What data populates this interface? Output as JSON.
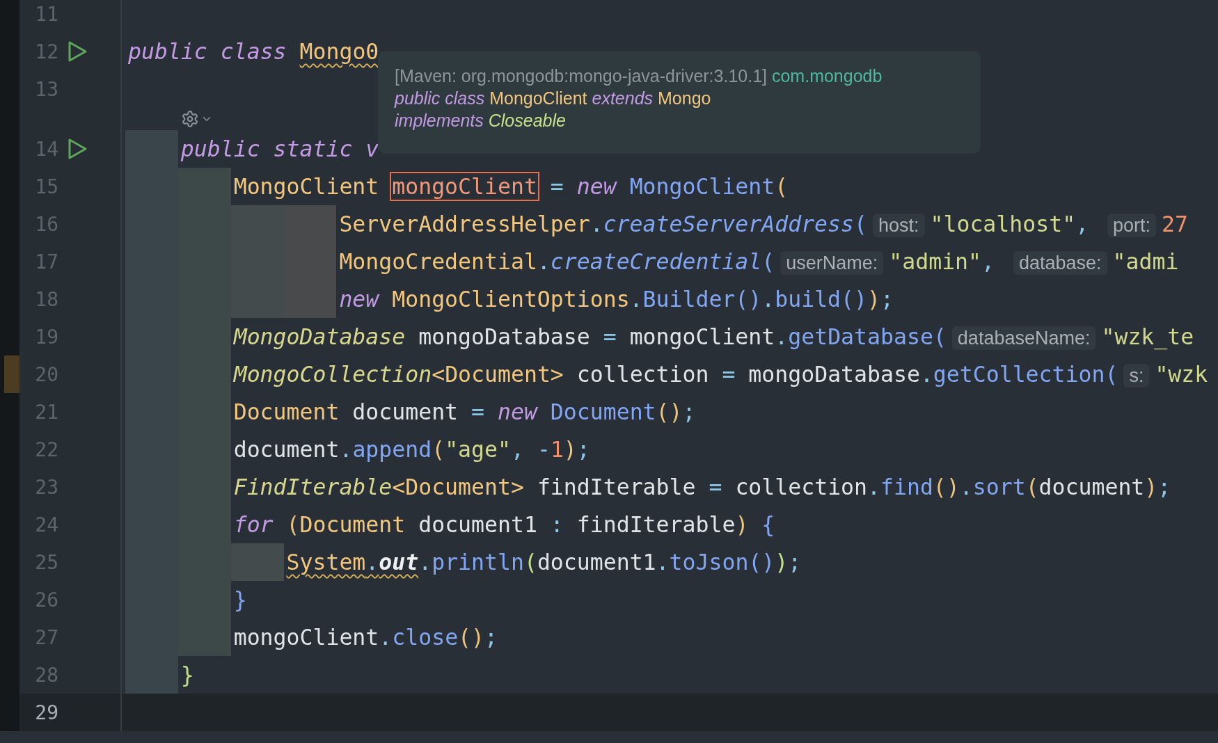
{
  "editor": {
    "lines": [
      {
        "kind": "code",
        "number": "11",
        "run": false,
        "current": false,
        "marker": false
      },
      {
        "kind": "code",
        "number": "12",
        "run": true,
        "current": false,
        "marker": false,
        "tokens": [
          {
            "kind": "kw",
            "text": "public class "
          },
          {
            "kind": "type",
            "text": "Mongo0",
            "warn": true
          }
        ]
      },
      {
        "kind": "code",
        "number": "13",
        "run": false,
        "current": false,
        "marker": false
      },
      {
        "kind": "inlay"
      },
      {
        "kind": "code",
        "number": "14",
        "run": true,
        "current": false,
        "marker": false,
        "guides": [
          {
            "color": "#3a444b"
          }
        ],
        "tokens": [
          {
            "kind": "kw",
            "text": "public static v"
          }
        ]
      },
      {
        "kind": "code",
        "number": "15",
        "run": false,
        "current": false,
        "marker": false,
        "guides": [
          {
            "color": "#3a444b"
          },
          {
            "color": "#3d4949"
          }
        ],
        "tokens": [
          {
            "kind": "type",
            "text": "MongoClient "
          },
          {
            "kind": "ref",
            "text": "mongoClient"
          },
          {
            "kind": "op",
            "text": " = "
          },
          {
            "kind": "kw",
            "text": "new "
          },
          {
            "kind": "method",
            "text": "MongoClient"
          },
          {
            "kind": "p1",
            "text": "("
          }
        ]
      },
      {
        "kind": "code",
        "number": "16",
        "run": false,
        "current": false,
        "marker": false,
        "guides": [
          {
            "color": "#3a444b"
          },
          {
            "color": "#3d4949"
          },
          {
            "color": "#434b4c"
          },
          {
            "color": "#484a4c"
          }
        ],
        "tokens": [
          {
            "kind": "type",
            "text": "ServerAddressHelper"
          },
          {
            "kind": "op",
            "text": "."
          },
          {
            "kind": "imethod",
            "text": "createServerAddress"
          },
          {
            "kind": "p2",
            "text": "("
          },
          {
            "kind": "hint",
            "text": "host:"
          },
          {
            "kind": "string",
            "text": "\"localhost\""
          },
          {
            "kind": "op",
            "text": ", "
          },
          {
            "kind": "hint",
            "text": "port:"
          },
          {
            "kind": "number",
            "text": "27"
          }
        ]
      },
      {
        "kind": "code",
        "number": "17",
        "run": false,
        "current": false,
        "marker": false,
        "guides": [
          {
            "color": "#3a444b"
          },
          {
            "color": "#3d4949"
          },
          {
            "color": "#434b4c"
          },
          {
            "color": "#484a4c"
          }
        ],
        "tokens": [
          {
            "kind": "type",
            "text": "MongoCredential"
          },
          {
            "kind": "op",
            "text": "."
          },
          {
            "kind": "imethod",
            "text": "createCredential"
          },
          {
            "kind": "p2",
            "text": "("
          },
          {
            "kind": "hint",
            "text": "userName:"
          },
          {
            "kind": "string",
            "text": "\"admin\""
          },
          {
            "kind": "op",
            "text": ", "
          },
          {
            "kind": "hint",
            "text": "database:"
          },
          {
            "kind": "string",
            "text": "\"admi"
          }
        ]
      },
      {
        "kind": "code",
        "number": "18",
        "run": false,
        "current": false,
        "marker": false,
        "guides": [
          {
            "color": "#3a444b"
          },
          {
            "color": "#3d4949"
          },
          {
            "color": "#434b4c"
          },
          {
            "color": "#484a4c"
          }
        ],
        "tokens": [
          {
            "kind": "kw",
            "text": "new "
          },
          {
            "kind": "type",
            "text": "MongoClientOptions"
          },
          {
            "kind": "op",
            "text": "."
          },
          {
            "kind": "method",
            "text": "Builder"
          },
          {
            "kind": "p2",
            "text": "()"
          },
          {
            "kind": "op",
            "text": "."
          },
          {
            "kind": "method",
            "text": "build"
          },
          {
            "kind": "p2",
            "text": "()"
          },
          {
            "kind": "p1",
            "text": ")"
          },
          {
            "kind": "op",
            "text": ";"
          }
        ]
      },
      {
        "kind": "code",
        "number": "19",
        "run": false,
        "current": false,
        "marker": false,
        "guides": [
          {
            "color": "#3a444b"
          },
          {
            "color": "#3d4949"
          }
        ],
        "tokens": [
          {
            "kind": "itype",
            "text": "MongoDatabase"
          },
          {
            "kind": "plain",
            "text": " mongoDatabase "
          },
          {
            "kind": "op",
            "text": "= "
          },
          {
            "kind": "plain",
            "text": "mongoClient"
          },
          {
            "kind": "op",
            "text": "."
          },
          {
            "kind": "method",
            "text": "getDatabase"
          },
          {
            "kind": "p2",
            "text": "("
          },
          {
            "kind": "hint",
            "text": "databaseName:"
          },
          {
            "kind": "string",
            "text": "\"wzk_te"
          }
        ]
      },
      {
        "kind": "code",
        "number": "20",
        "run": false,
        "current": false,
        "marker": true,
        "guides": [
          {
            "color": "#3a444b"
          },
          {
            "color": "#3d4949"
          }
        ],
        "tokens": [
          {
            "kind": "itype",
            "text": "MongoCollection"
          },
          {
            "kind": "type",
            "text": "<Document>"
          },
          {
            "kind": "plain",
            "text": " collection "
          },
          {
            "kind": "op",
            "text": "= "
          },
          {
            "kind": "plain",
            "text": "mongoDatabase"
          },
          {
            "kind": "op",
            "text": "."
          },
          {
            "kind": "method",
            "text": "getCollection"
          },
          {
            "kind": "p2",
            "text": "("
          },
          {
            "kind": "hint",
            "text": "s:"
          },
          {
            "kind": "string",
            "text": "\"wzk"
          }
        ]
      },
      {
        "kind": "code",
        "number": "21",
        "run": false,
        "current": false,
        "marker": false,
        "guides": [
          {
            "color": "#3a444b"
          },
          {
            "color": "#3d4949"
          }
        ],
        "tokens": [
          {
            "kind": "type",
            "text": "Document"
          },
          {
            "kind": "plain",
            "text": " document "
          },
          {
            "kind": "op",
            "text": "= "
          },
          {
            "kind": "kw",
            "text": "new "
          },
          {
            "kind": "method",
            "text": "Document"
          },
          {
            "kind": "p1",
            "text": "()"
          },
          {
            "kind": "op",
            "text": ";"
          }
        ]
      },
      {
        "kind": "code",
        "number": "22",
        "run": false,
        "current": false,
        "marker": false,
        "guides": [
          {
            "color": "#3a444b"
          },
          {
            "color": "#3d4949"
          }
        ],
        "tokens": [
          {
            "kind": "plain",
            "text": "document"
          },
          {
            "kind": "op",
            "text": "."
          },
          {
            "kind": "method",
            "text": "append"
          },
          {
            "kind": "p1",
            "text": "("
          },
          {
            "kind": "string",
            "text": "\"age\""
          },
          {
            "kind": "op",
            "text": ", -"
          },
          {
            "kind": "number",
            "text": "1"
          },
          {
            "kind": "p1",
            "text": ")"
          },
          {
            "kind": "op",
            "text": ";"
          }
        ]
      },
      {
        "kind": "code",
        "number": "23",
        "run": false,
        "current": false,
        "marker": false,
        "guides": [
          {
            "color": "#3a444b"
          },
          {
            "color": "#3d4949"
          }
        ],
        "tokens": [
          {
            "kind": "itype",
            "text": "FindIterable"
          },
          {
            "kind": "type",
            "text": "<Document>"
          },
          {
            "kind": "plain",
            "text": " findIterable "
          },
          {
            "kind": "op",
            "text": "= "
          },
          {
            "kind": "plain",
            "text": "collection"
          },
          {
            "kind": "op",
            "text": "."
          },
          {
            "kind": "method",
            "text": "find"
          },
          {
            "kind": "p1",
            "text": "()"
          },
          {
            "kind": "op",
            "text": "."
          },
          {
            "kind": "method",
            "text": "sort"
          },
          {
            "kind": "p1",
            "text": "("
          },
          {
            "kind": "plain",
            "text": "document"
          },
          {
            "kind": "p1",
            "text": ")"
          },
          {
            "kind": "op",
            "text": ";"
          }
        ]
      },
      {
        "kind": "code",
        "number": "24",
        "run": false,
        "current": false,
        "marker": false,
        "guides": [
          {
            "color": "#3a444b"
          },
          {
            "color": "#3d4949"
          }
        ],
        "tokens": [
          {
            "kind": "kw",
            "text": "for "
          },
          {
            "kind": "p1",
            "text": "("
          },
          {
            "kind": "type",
            "text": "Document"
          },
          {
            "kind": "plain",
            "text": " document1 "
          },
          {
            "kind": "op",
            "text": ": "
          },
          {
            "kind": "plain",
            "text": "findIterable"
          },
          {
            "kind": "p1",
            "text": ") "
          },
          {
            "kind": "p2",
            "text": "{"
          }
        ]
      },
      {
        "kind": "code",
        "number": "25",
        "run": false,
        "current": false,
        "marker": false,
        "guides": [
          {
            "color": "#3a444b"
          },
          {
            "color": "#3d4949"
          },
          {
            "color": "#434b4c"
          }
        ],
        "tokens": [
          {
            "kind": "type",
            "text": "System",
            "warn": true
          },
          {
            "kind": "op",
            "text": ".",
            "warn": true
          },
          {
            "kind": "field",
            "text": "out",
            "warn": true
          },
          {
            "kind": "op",
            "text": "."
          },
          {
            "kind": "method",
            "text": "println"
          },
          {
            "kind": "p3",
            "text": "("
          },
          {
            "kind": "plain",
            "text": "document1"
          },
          {
            "kind": "op",
            "text": "."
          },
          {
            "kind": "method",
            "text": "toJson"
          },
          {
            "kind": "p2",
            "text": "()"
          },
          {
            "kind": "p3",
            "text": ")"
          },
          {
            "kind": "op",
            "text": ";"
          }
        ]
      },
      {
        "kind": "code",
        "number": "26",
        "run": false,
        "current": false,
        "marker": false,
        "guides": [
          {
            "color": "#3a444b"
          },
          {
            "color": "#3d4949"
          }
        ],
        "tokens": [
          {
            "kind": "p2",
            "text": "}"
          }
        ]
      },
      {
        "kind": "code",
        "number": "27",
        "run": false,
        "current": false,
        "marker": false,
        "guides": [
          {
            "color": "#3a444b"
          },
          {
            "color": "#3d4949"
          }
        ],
        "tokens": [
          {
            "kind": "plain",
            "text": "mongoClient"
          },
          {
            "kind": "op",
            "text": "."
          },
          {
            "kind": "method",
            "text": "close"
          },
          {
            "kind": "p1",
            "text": "()"
          },
          {
            "kind": "op",
            "text": ";"
          }
        ]
      },
      {
        "kind": "code",
        "number": "28",
        "run": false,
        "current": false,
        "marker": false,
        "guides": [
          {
            "color": "#3a444b"
          }
        ],
        "tokens": [
          {
            "kind": "p3",
            "text": "}"
          }
        ]
      },
      {
        "kind": "code",
        "number": "29",
        "run": false,
        "current": true,
        "marker": false
      }
    ]
  },
  "tooltip": {
    "lines": [
      [
        {
          "kind": "meta",
          "text": "[Maven: org.mongodb:mongo-java-driver:3.10.1] "
        },
        {
          "kind": "package",
          "text": "com.mongodb"
        }
      ],
      [
        {
          "kind": "kw",
          "text": "public class "
        },
        {
          "kind": "type",
          "text": "MongoClient "
        },
        {
          "kind": "kw",
          "text": "extends "
        },
        {
          "kind": "type",
          "text": "Mongo"
        }
      ],
      [
        {
          "kind": "kw",
          "text": "implements "
        },
        {
          "kind": "iface",
          "text": "Closeable"
        }
      ]
    ]
  }
}
